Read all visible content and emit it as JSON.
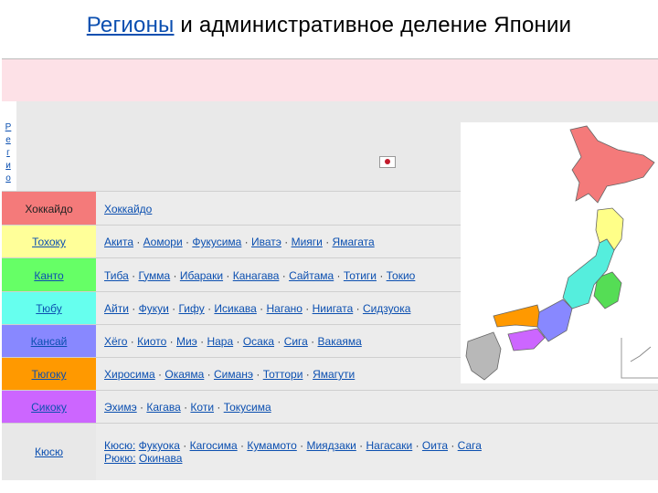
{
  "title": {
    "link": "Регионы",
    "rest": " и административное деление  Японии"
  },
  "side_label": [
    "Р",
    "е",
    "г",
    "и",
    "о"
  ],
  "rows": [
    {
      "name": "Хоккайдо",
      "color": "#f47a7a",
      "prefs": [
        "Хоккайдо"
      ],
      "label_link": false
    },
    {
      "name": "Тохоку",
      "color": "#ffff99",
      "prefs": [
        "Акита",
        "Аомори",
        "Фукусима",
        "Иватэ",
        "Мияги",
        "Ямагата"
      ],
      "label_link": true
    },
    {
      "name": "Канто",
      "color": "#66ff66",
      "prefs": [
        "Тиба",
        "Гумма",
        "Ибараки",
        "Канагава",
        "Сайтама",
        "Тотиги",
        "Токио"
      ],
      "label_link": true
    },
    {
      "name": "Тюбу",
      "color": "#66ffee",
      "prefs": [
        "Айти",
        "Фукуи",
        "Гифу",
        "Исикава",
        "Нагано",
        "Ниигата",
        "Сидзуока"
      ],
      "label_link": true
    },
    {
      "name": "Кансай",
      "color": "#8888ff",
      "prefs": [
        "Хёго",
        "Киото",
        "Миэ",
        "Нара",
        "Осака",
        "Сига",
        "Вакаяма"
      ],
      "label_link": true
    },
    {
      "name": "Тюгоку",
      "color": "#ff9900",
      "prefs": [
        "Хиросима",
        "Окаяма",
        "Симанэ",
        "Тоттори",
        "Ямагути"
      ],
      "label_link": true
    },
    {
      "name": "Сикоку",
      "color": "#cc66ff",
      "prefs": [
        "Эхимэ",
        "Кагава",
        "Коти",
        "Токусима"
      ],
      "label_link": true
    },
    {
      "name": "Кюсю",
      "color": "#e8e8e8",
      "line1": [
        "Кюсю:",
        "Фукуока",
        "Кагосима",
        "Кумамото",
        "Миядзаки",
        "Нагасаки",
        "Оита",
        "Сага"
      ],
      "line2": [
        "Рюкю:",
        "Окинава"
      ],
      "label_link": true
    }
  ]
}
